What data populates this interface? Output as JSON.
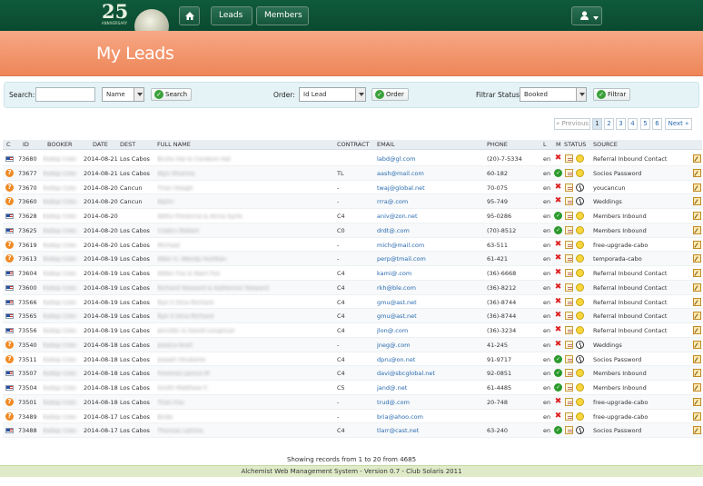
{
  "logo": {
    "number": "25",
    "tagline": "ANNIVERSARY",
    "brand": "Club Solaris"
  },
  "nav": {
    "leads_label": "Leads",
    "members_label": "Members"
  },
  "page": {
    "title": "My Leads"
  },
  "filters": {
    "search_label": "Search:",
    "search_value": "",
    "search_field_selected": "Name",
    "search_button": "Search",
    "order_label": "Order:",
    "order_selected": "Id Lead",
    "order_button": "Order",
    "status_label": "Filtrar Status:",
    "status_selected": "Booked",
    "status_button": "Filtrar"
  },
  "pagination": {
    "previous": "« Previous",
    "pages": [
      "1",
      "2",
      "3",
      "4",
      "5",
      "6"
    ],
    "active_page": "1",
    "next": "Next »"
  },
  "table": {
    "columns": [
      "C",
      "ID",
      "BOOKER",
      "DATE",
      "DEST",
      "FULL NAME",
      "CONTRACT",
      "EMAIL",
      "PHONE",
      "L",
      "M",
      "STATUS",
      "SOURCE"
    ],
    "rows": [
      {
        "c": "flag",
        "id": "73680",
        "booker": "Ksdop Coto",
        "date": "2014-08-21",
        "dest": "Los Cabos",
        "fullname": "Bruhs Hal & Condum Hal",
        "contract": "",
        "email": "labd@gl.com",
        "phone": "(20)-7-5334",
        "l": "en",
        "m": "x",
        "status": "smile",
        "source": "Referral Inbound Contact"
      },
      {
        "c": "q",
        "id": "73677",
        "booker": "Ksdop Coto",
        "date": "2014-08-21",
        "dest": "Los Cabos",
        "fullname": "Alyn Sharma",
        "contract": "TL",
        "email": "aash@mail.com",
        "phone": "60-182",
        "l": "en",
        "m": "check",
        "status": "smile",
        "source": "Socios Password"
      },
      {
        "c": "q",
        "id": "73670",
        "booker": "Ksdop Coto",
        "date": "2014-08-20",
        "dest": "Cancun",
        "fullname": "Tiran Heagh",
        "contract": "-",
        "email": "twaj@global.net",
        "phone": "70-075",
        "l": "en",
        "m": "x",
        "status": "clock",
        "source": "youcancun"
      },
      {
        "c": "q",
        "id": "73660",
        "booker": "Ksdop Coto",
        "date": "2014-08-20",
        "dest": "Cancun",
        "fullname": "Alyhn",
        "contract": "-",
        "email": "rrra@.com",
        "phone": "95-749",
        "l": "en",
        "m": "x",
        "status": "clock",
        "source": "Weddings"
      },
      {
        "c": "flag",
        "id": "73628",
        "booker": "Ksdop Coto",
        "date": "2014-08-20",
        "dest": "",
        "fullname": "Abfra Florencia & Anna Syrla",
        "contract": "C4",
        "email": "aniv@zon.net",
        "phone": "95-0286",
        "l": "en",
        "m": "check",
        "status": "smile",
        "source": "Members Inbound"
      },
      {
        "c": "flag",
        "id": "73625",
        "booker": "Ksdop Coto",
        "date": "2014-08-20",
        "dest": "Los Cabos",
        "fullname": "Coskru Robert",
        "contract": "C0",
        "email": "drdt@.com",
        "phone": "(70)-8512",
        "l": "en",
        "m": "check",
        "status": "smile",
        "source": "Members Inbound"
      },
      {
        "c": "q",
        "id": "73619",
        "booker": "Ksdop Coto",
        "date": "2014-08-20",
        "dest": "Los Cabos",
        "fullname": "Michaal",
        "contract": "-",
        "email": "mich@mail.com",
        "phone": "63-511",
        "l": "en",
        "m": "x",
        "status": "smile",
        "source": "free-upgrade-cabo"
      },
      {
        "c": "q",
        "id": "73613",
        "booker": "Ksdop Coto",
        "date": "2014-08-19",
        "dest": "Los Cabos",
        "fullname": "Allen S. Wendy Huhltan",
        "contract": "-",
        "email": "perp@tmail.com",
        "phone": "61-421",
        "l": "en",
        "m": "x",
        "status": "smile",
        "source": "temporada-cabo"
      },
      {
        "c": "flag",
        "id": "73604",
        "booker": "Ksdop Coto",
        "date": "2014-08-19",
        "dest": "Los Cabos",
        "fullname": "Alden Fox & Nam Fox",
        "contract": "C4",
        "email": "kami@.com",
        "phone": "(36)-6668",
        "l": "en",
        "m": "x",
        "status": "smile",
        "source": "Referral Inbound Contact"
      },
      {
        "c": "flag",
        "id": "73600",
        "booker": "Ksdop Coto",
        "date": "2014-08-19",
        "dest": "Los Cabos",
        "fullname": "Richard Steward & Katherine Steward",
        "contract": "C4",
        "email": "rkh@ble.com",
        "phone": "(36)-8212",
        "l": "en",
        "m": "x",
        "status": "smile",
        "source": "Referral Inbound Contact"
      },
      {
        "c": "flag",
        "id": "73566",
        "booker": "Ksdop Coto",
        "date": "2014-08-19",
        "dest": "Los Cabos",
        "fullname": "Rye S Gina Richard",
        "contract": "C4",
        "email": "gmu@ast.net",
        "phone": "(36)-8744",
        "l": "en",
        "m": "x",
        "status": "smile",
        "source": "Referral Inbound Contact"
      },
      {
        "c": "flag",
        "id": "73565",
        "booker": "Ksdop Coto",
        "date": "2014-08-19",
        "dest": "Los Cabos",
        "fullname": "Rye S Gina Richard",
        "contract": "C4",
        "email": "gmu@ast.net",
        "phone": "(36)-8744",
        "l": "en",
        "m": "x",
        "status": "smile",
        "source": "Referral Inbound Contact"
      },
      {
        "c": "flag",
        "id": "73556",
        "booker": "Ksdop Coto",
        "date": "2014-08-19",
        "dest": "Los Cabos",
        "fullname": "Jennifer & David Longmuir",
        "contract": "C4",
        "email": "jlon@.com",
        "phone": "(36)-3234",
        "l": "en",
        "m": "x",
        "status": "smile",
        "source": "Referral Inbound Contact"
      },
      {
        "c": "q",
        "id": "73540",
        "booker": "Ksdop Coto",
        "date": "2014-08-18",
        "dest": "Los Cabos",
        "fullname": "Jessica Kroll",
        "contract": "-",
        "email": "jneg@.com",
        "phone": "41-245",
        "l": "en",
        "m": "x",
        "status": "clock",
        "source": "Weddings"
      },
      {
        "c": "q",
        "id": "73511",
        "booker": "Ksdop Coto",
        "date": "2014-08-18",
        "dest": "Los Cabos",
        "fullname": "Joseph Shuberte",
        "contract": "C4",
        "email": "dpru@on.net",
        "phone": "91-9717",
        "l": "en",
        "m": "check",
        "status": "clock",
        "source": "Socios Password"
      },
      {
        "c": "flag",
        "id": "73507",
        "booker": "Ksdop Coto",
        "date": "2014-08-18",
        "dest": "Los Cabos",
        "fullname": "Foreman Janice M",
        "contract": "C4",
        "email": "davi@sbcglobal.net",
        "phone": "92-0851",
        "l": "en",
        "m": "check",
        "status": "smile",
        "source": "Members Inbound"
      },
      {
        "c": "flag",
        "id": "73504",
        "booker": "Ksdop Coto",
        "date": "2014-08-18",
        "dest": "Los Cabos",
        "fullname": "Smith Matthew F.",
        "contract": "C5",
        "email": "jand@.net",
        "phone": "61-4485",
        "l": "en",
        "m": "check",
        "status": "smile",
        "source": "Members Inbound"
      },
      {
        "c": "q",
        "id": "73501",
        "booker": "Ksdop Coto",
        "date": "2014-08-18",
        "dest": "Los Cabos",
        "fullname": "Tiran Fox",
        "contract": "-",
        "email": "trud@.com",
        "phone": "20-748",
        "l": "en",
        "m": "x",
        "status": "smile",
        "source": "free-upgrade-cabo"
      },
      {
        "c": "q",
        "id": "73489",
        "booker": "Ksdop Coto",
        "date": "2014-08-17",
        "dest": "Los Cabos",
        "fullname": "Bride",
        "contract": "-",
        "email": "bria@ahoo.com",
        "phone": "",
        "l": "en",
        "m": "x",
        "status": "smile",
        "source": "free-upgrade-cabo"
      },
      {
        "c": "flag",
        "id": "73488",
        "booker": "Ksdop Coto",
        "date": "2014-08-17",
        "dest": "Los Cabos",
        "fullname": "Thomas Larrine",
        "contract": "C4",
        "email": "tlarr@cast.net",
        "phone": "63-240",
        "l": "en",
        "m": "check",
        "status": "clock",
        "source": "Socios Password"
      }
    ]
  },
  "records_text": "Showing records from 1 to 20 from 4685",
  "footer_text": "Alchemist Web Management System - Version 0.7 - Club Solaris 2011"
}
